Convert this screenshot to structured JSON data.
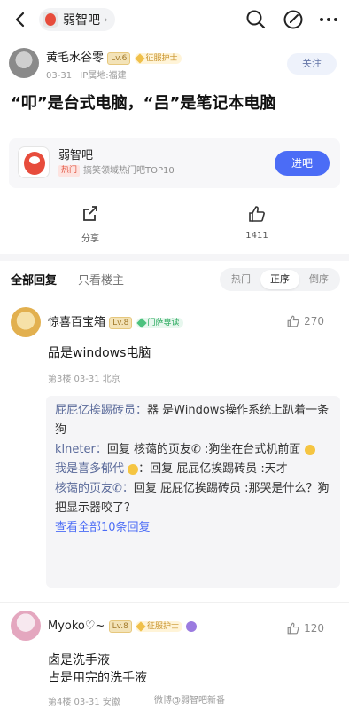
{
  "nav": {
    "forum_name": "弱智吧",
    "icons": [
      "back-icon",
      "search-icon",
      "edit-icon",
      "more-icon"
    ]
  },
  "post": {
    "author": "黄毛水谷零",
    "level": "Lv.6",
    "badge": "征服护士",
    "date": "03-31",
    "ip": "IP属地:福建",
    "follow_label": "关注",
    "title": "“叩”是台式电脑，“吕”是笔记本电脑"
  },
  "forum_card": {
    "name": "弱智吧",
    "hot_tag": "热门",
    "desc": "搞笑领域热门吧TOP10",
    "enter_label": "进吧"
  },
  "actions": {
    "share_label": "分享",
    "like_count": "1411"
  },
  "reply_tabs": {
    "all": "全部回复",
    "op_only": "只看楼主",
    "sort_hot": "热门",
    "sort_asc": "正序",
    "sort_desc": "倒序"
  },
  "comments": [
    {
      "name": "惊喜百宝箱",
      "level": "Lv.8",
      "badge": "门萨専读",
      "likes": "270",
      "text": "品是windows电脑",
      "meta": "第3楼  03-31  北京",
      "replies": [
        {
          "who": "屁屁亿挨踢砖员：",
          "text": "器 是Windows操作系统上趴着一条狗"
        },
        {
          "who": "klneter：",
          "text": "回复 核蔼的页友✆ :狗坐在台式机前面"
        },
        {
          "who": "我是喜多郁代",
          "text": "：回复 屁屁亿挨踢砖员 :天才"
        },
        {
          "who": "核蔼的页友✆：",
          "text": "回复 屁屁亿挨踢砖员 :那哭是什么？狗把显示器咬了？"
        }
      ],
      "more_replies": "查看全部10条回复"
    },
    {
      "name": "Myoko♡~",
      "level": "Lv.8",
      "badge": "征服护士",
      "likes": "120",
      "text_line1": "卤是洗手液",
      "text_line2": "占是用完的洗手液",
      "meta": "第4楼  03-31  安徽"
    }
  ],
  "watermark": "微博@弱智吧新番"
}
